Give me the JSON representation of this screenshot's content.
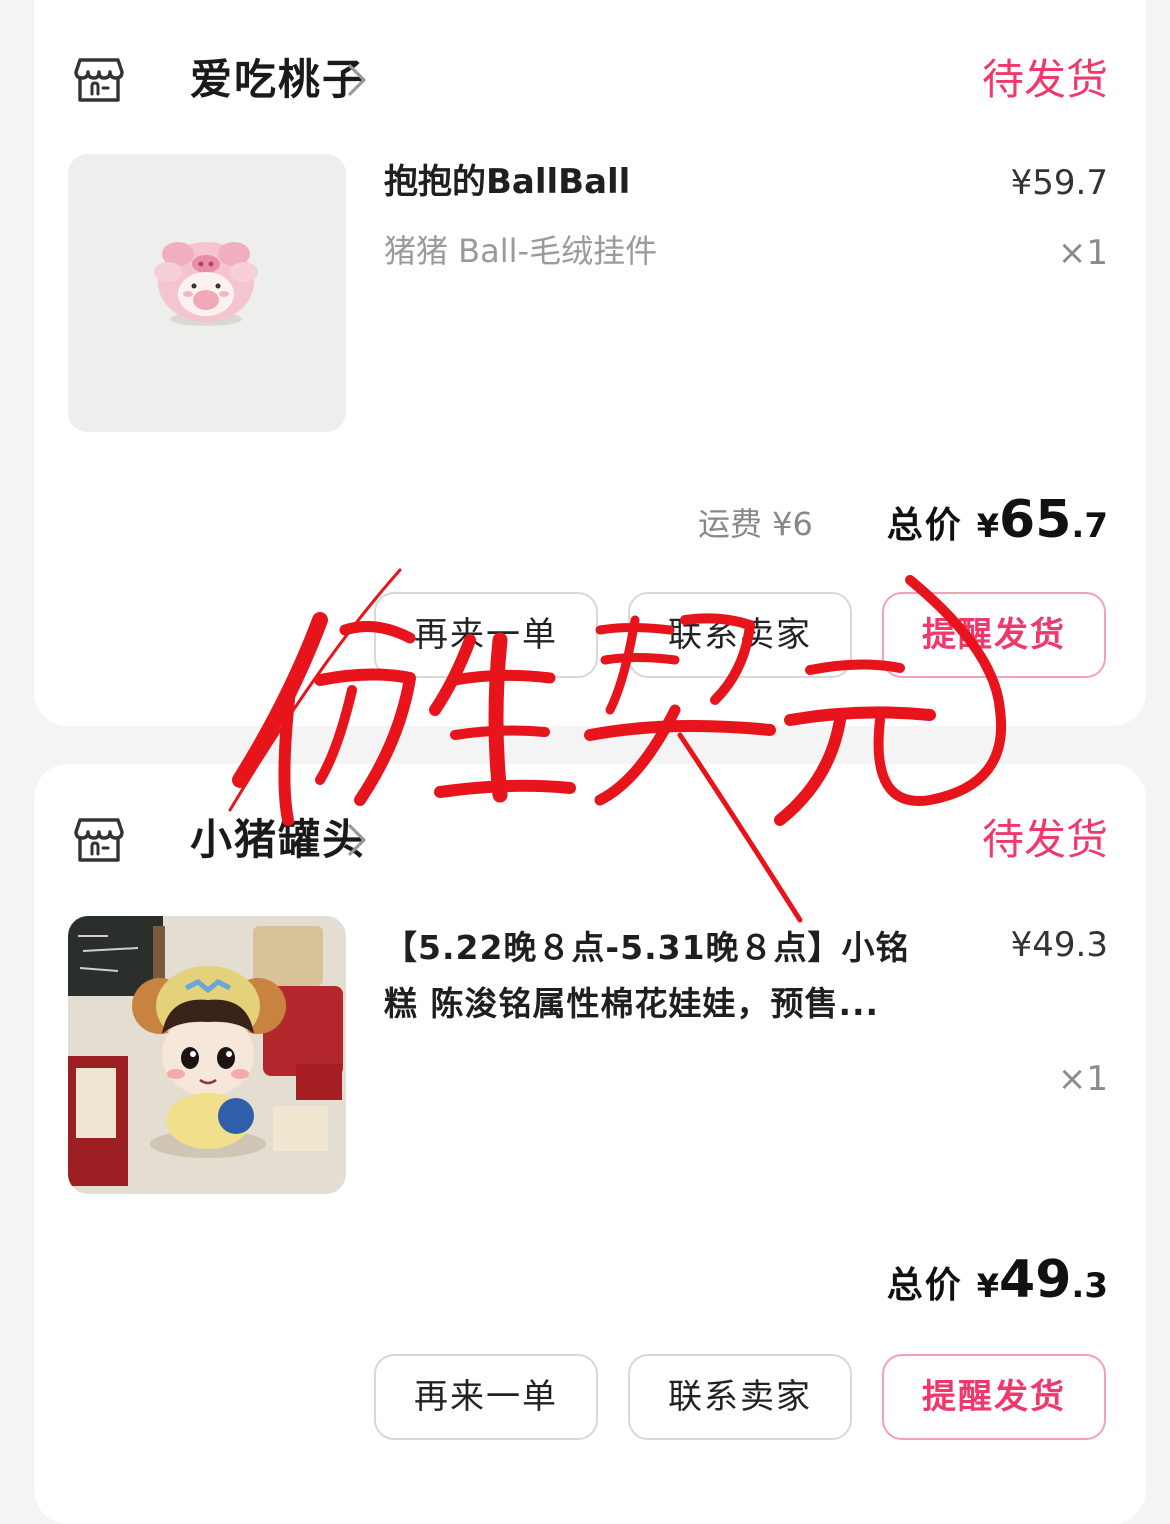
{
  "orders": [
    {
      "shop_name": "爱吃桃子",
      "status": "待发货",
      "product_title": "抱抱的BallBall",
      "product_spec": "猪猪 Ball-毛绒挂件",
      "unit_price": "¥59.7",
      "quantity": "×1",
      "shipping": "运费 ¥6",
      "total_label": "总价",
      "total_symbol": "¥",
      "total_integer": "65",
      "total_decimal": ".7",
      "buttons": {
        "reorder": "再来一单",
        "contact": "联系卖家",
        "remind": "提醒发货"
      }
    },
    {
      "shop_name": "小猪罐头",
      "status": "待发货",
      "product_title_line1": "【5.22晚８点-5.31晚８点】小铭",
      "product_title_line2": "糕 陈浚铭属性棉花娃娃，预售...",
      "unit_price": "¥49.3",
      "quantity": "×1",
      "total_label": "总价",
      "total_symbol": "¥",
      "total_integer": "49",
      "total_decimal": ".3",
      "buttons": {
        "reorder": "再来一单",
        "contact": "联系卖家",
        "remind": "提醒发货"
      }
    }
  ],
  "watermark_text": "仿生契元",
  "colors": {
    "accent": "#f0386b",
    "watermark": "#e8141b"
  }
}
